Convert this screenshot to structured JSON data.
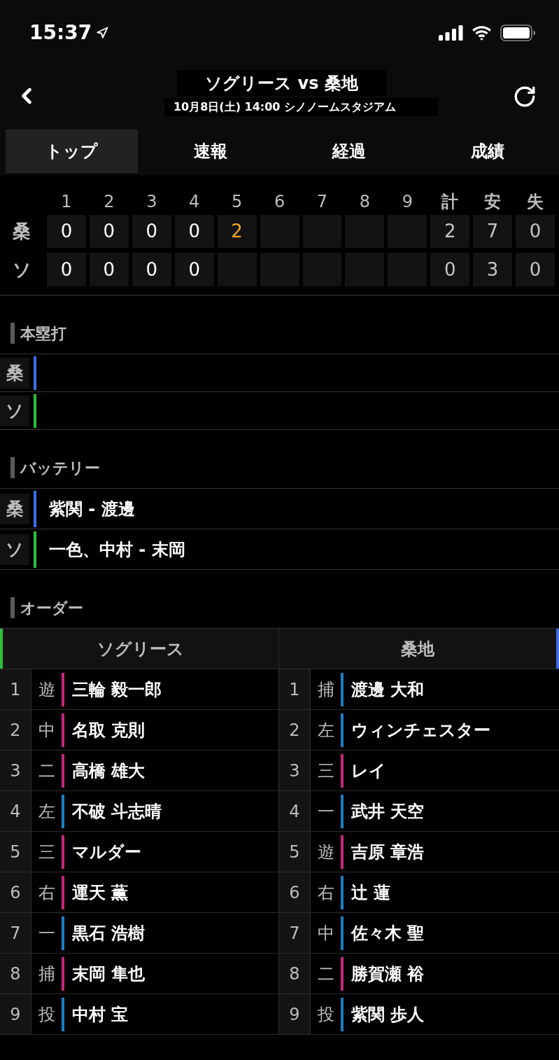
{
  "status_bar": {
    "time": "15:37"
  },
  "nav": {
    "title": "ソグリース vs 桑地",
    "subtitle": "10月8日(土) 14:00 シノノームスタジアム"
  },
  "tabs": [
    {
      "label": "トップ",
      "selected": true
    },
    {
      "label": "速報",
      "selected": false
    },
    {
      "label": "経過",
      "selected": false
    },
    {
      "label": "成績",
      "selected": false
    }
  ],
  "scoreboard": {
    "inning_labels": [
      "1",
      "2",
      "3",
      "4",
      "5",
      "6",
      "7",
      "8",
      "9"
    ],
    "total_labels": [
      "計",
      "安",
      "失"
    ],
    "rows": [
      {
        "team": "桑",
        "innings": [
          {
            "score": "0",
            "live": false
          },
          {
            "score": "0",
            "live": false
          },
          {
            "score": "0",
            "live": false
          },
          {
            "score": "0",
            "live": false
          },
          {
            "score": "2",
            "live": true
          }
        ],
        "totals": [
          "2",
          "7",
          "0"
        ]
      },
      {
        "team": "ソ",
        "innings": [
          {
            "score": "0",
            "live": false
          },
          {
            "score": "0",
            "live": false
          },
          {
            "score": "0",
            "live": false
          },
          {
            "score": "0",
            "live": false
          }
        ],
        "totals": [
          "0",
          "3",
          "0"
        ]
      }
    ]
  },
  "home_runs": {
    "heading": "本塁打",
    "rows": [
      {
        "team": "桑",
        "color": "#3d6ee8"
      },
      {
        "team": "ソ",
        "color": "#2cc03c"
      }
    ]
  },
  "battery": {
    "heading": "バッテリー",
    "rows": [
      {
        "team": "桑",
        "color": "#3d6ee8",
        "players": "紫関 - 渡邊"
      },
      {
        "team": "ソ",
        "color": "#2cc03c",
        "players": "一色、中村 - 末岡"
      }
    ]
  },
  "order": {
    "heading": "オーダー",
    "teams": [
      {
        "name": "ソグリース",
        "color": "#2cc03c",
        "lineup": [
          {
            "order": "1",
            "position": "遊",
            "player": "三輪 毅一郎",
            "color": "#c4277f"
          },
          {
            "order": "2",
            "position": "中",
            "player": "名取 克則",
            "color": "#c4277f"
          },
          {
            "order": "3",
            "position": "二",
            "player": "高橋 雄大",
            "color": "#c4277f"
          },
          {
            "order": "4",
            "position": "左",
            "player": "不破 斗志晴",
            "color": "#1a7ec4"
          },
          {
            "order": "5",
            "position": "三",
            "player": "マルダー",
            "color": "#c4277f"
          },
          {
            "order": "6",
            "position": "右",
            "player": "運天 薫",
            "color": "#c4277f"
          },
          {
            "order": "7",
            "position": "一",
            "player": "黒石 浩樹",
            "color": "#1a7ec4"
          },
          {
            "order": "8",
            "position": "捕",
            "player": "末岡 隼也",
            "color": "#c4277f"
          },
          {
            "order": "9",
            "position": "投",
            "player": "中村 宝",
            "color": "#1a7ec4"
          }
        ]
      },
      {
        "name": "桑地",
        "color": "#3d6ee8",
        "lineup": [
          {
            "order": "1",
            "position": "捕",
            "player": "渡邊 大和",
            "color": "#1a7ec4"
          },
          {
            "order": "2",
            "position": "左",
            "player": "ウィンチェスター",
            "color": "#1a7ec4"
          },
          {
            "order": "3",
            "position": "三",
            "player": "レイ",
            "color": "#c4277f"
          },
          {
            "order": "4",
            "position": "一",
            "player": "武井 天空",
            "color": "#1a7ec4"
          },
          {
            "order": "5",
            "position": "遊",
            "player": "吉原 章浩",
            "color": "#c4277f"
          },
          {
            "order": "6",
            "position": "右",
            "player": "辻 蓮",
            "color": "#1a7ec4"
          },
          {
            "order": "7",
            "position": "中",
            "player": "佐々木 聖",
            "color": "#1a7ec4"
          },
          {
            "order": "8",
            "position": "二",
            "player": "勝賀瀬 裕",
            "color": "#c4277f"
          },
          {
            "order": "9",
            "position": "投",
            "player": "紫関 歩人",
            "color": "#1a7ec4"
          }
        ]
      }
    ]
  }
}
